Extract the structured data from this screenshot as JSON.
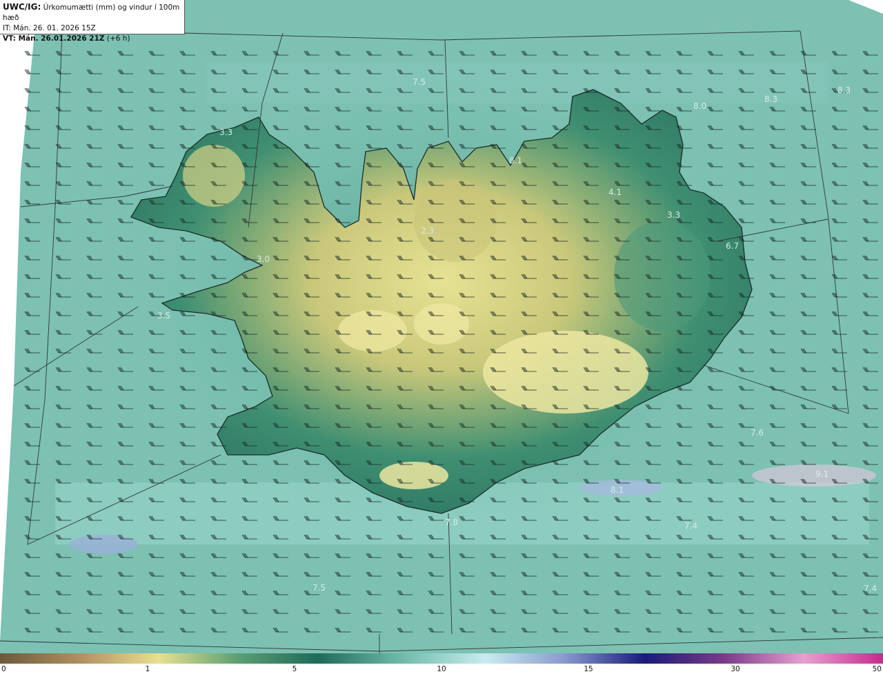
{
  "header": {
    "product": "UWC/IG:",
    "title": "Úrkomumætti (mm) og vindur í 100m hæð",
    "issue_time": "IT: Mán. 26. 01. 2026 15Z",
    "valid_label": "VT: Mán. 26.01.2026 21Z",
    "valid_offset": "(+6 h)"
  },
  "colorbar": {
    "ticks": [
      "0",
      "1",
      "5",
      "10",
      "15",
      "30",
      "50"
    ],
    "colors": [
      "#6b5a3a",
      "#b09060",
      "#e8e090",
      "#5aa070",
      "#1e6a5a",
      "#6ab8a8",
      "#c8ecef",
      "#8898d0",
      "#1a1a7a",
      "#7a3a8a",
      "#e8a0d0",
      "#c82890"
    ]
  },
  "map": {
    "background_color": "#7cc1b2",
    "land_low_color": "#2f7d66",
    "land_high_color": "#e0dc8e",
    "value_labels": [
      "7.5",
      "8.0",
      "8.3",
      "8.3",
      "3.3",
      "8.1",
      "4.1",
      "3.3",
      "2.3",
      "6.7",
      "3.0",
      "3.5",
      "7.6",
      "9.1",
      "7.4",
      "7.5",
      "7.4",
      "7.8",
      "8.1"
    ]
  }
}
